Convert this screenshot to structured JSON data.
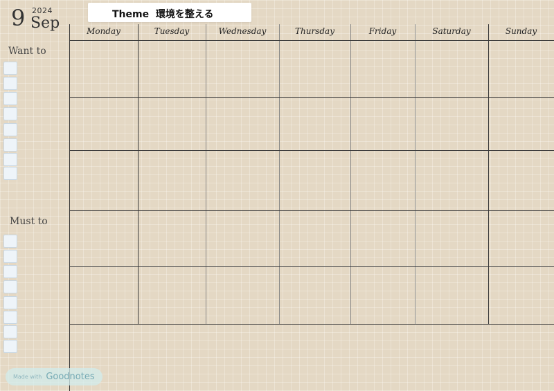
{
  "header": {
    "day": "9",
    "year": "2024",
    "month": "Sep",
    "theme_label": "Theme",
    "theme_value": "環境を整える"
  },
  "sidebar": {
    "want_title": "Want to",
    "must_title": "Must to"
  },
  "calendar": {
    "days": [
      "Monday",
      "Tuesday",
      "Wednesday",
      "Thursday",
      "Friday",
      "Saturday",
      "Sunday"
    ]
  },
  "badge": {
    "prefix": "Made with",
    "brand": "Goodnotes"
  }
}
